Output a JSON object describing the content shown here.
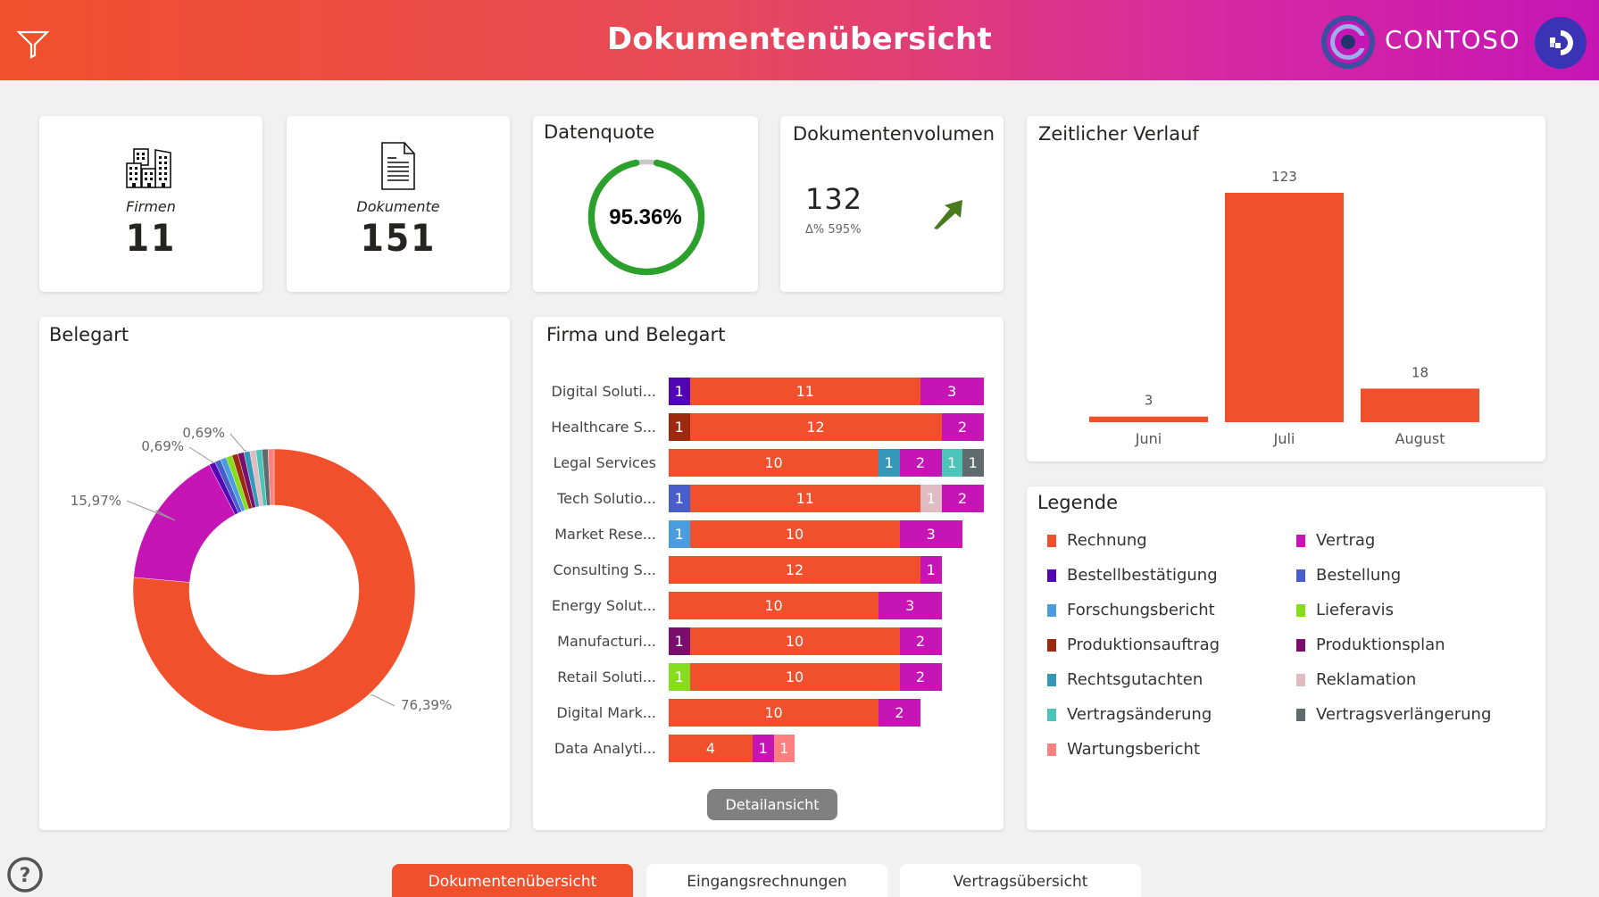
{
  "header": {
    "title": "Dokumentenübersicht",
    "brand": "CONTOSO",
    "icons": {
      "filter": "filter-icon",
      "logo": "contoso-logo-icon",
      "exit": "exit-icon"
    }
  },
  "kpis": {
    "firmen": {
      "label": "Firmen",
      "value": "11",
      "icon": "buildings-icon"
    },
    "dokumente": {
      "label": "Dokumente",
      "value": "151",
      "icon": "document-icon"
    },
    "datenquote": {
      "title": "Datenquote",
      "value_text": "95.36%",
      "fraction": 0.9536,
      "color": "#2ca02c"
    },
    "volumen": {
      "title": "Dokumentenvolumen",
      "value": "132",
      "delta": "Δ% 595%",
      "trend_icon": "trend-up-arrow-icon",
      "trend_color": "#4a7a1e"
    }
  },
  "colors": {
    "Rechnung": "#f0502b",
    "Vertrag": "#c516b5",
    "Bestellbestätigung": "#5205b5",
    "Bestellung": "#4a5ecb",
    "Forschungsbericht": "#4b9de0",
    "Lieferavis": "#85dd1e",
    "Produktionsauftrag": "#9d2a0e",
    "Produktionsplan": "#7a0e6c",
    "Rechtsgutachten": "#3498b8",
    "Reklamation": "#e0bcc2",
    "Vertragsänderung": "#4cc4ba",
    "Vertragsverlängerung": "#5f6b6d",
    "Wartungsbericht": "#fd8080"
  },
  "chart_data": [
    {
      "type": "pie",
      "title": "Belegart",
      "donut": true,
      "categories": [
        "Rechnung",
        "Vertrag",
        "Bestellbestätigung",
        "Bestellung",
        "Forschungsbericht",
        "Lieferavis",
        "Produktionsauftrag",
        "Produktionsplan",
        "Rechtsgutachten",
        "Reklamation",
        "Vertragsänderung",
        "Vertragsverlängerung",
        "Wartungsbericht"
      ],
      "values": [
        76.39,
        15.97,
        0.69,
        0.69,
        0.69,
        0.69,
        0.69,
        0.69,
        0.69,
        0.69,
        0.69,
        0.69,
        0.69
      ],
      "data_labels": [
        {
          "category": "Rechnung",
          "text": "76,39%"
        },
        {
          "category": "Vertrag",
          "text": "15,97%"
        },
        {
          "category": "Bestellbestätigung",
          "text": "0,69%"
        },
        {
          "category": "Rechtsgutachten",
          "text": "0,69%"
        }
      ]
    },
    {
      "type": "bar",
      "orientation": "horizontal",
      "stacked": true,
      "title": "Firma und Belegart",
      "categories": [
        "Digital Soluti...",
        "Healthcare S...",
        "Legal Services",
        "Tech Solutio...",
        "Market Rese...",
        "Consulting S...",
        "Energy Solut...",
        "Manufacturi...",
        "Retail Soluti...",
        "Digital Mark...",
        "Data Analyti..."
      ],
      "rows": [
        [
          {
            "type": "Bestellbestätigung",
            "value": 1
          },
          {
            "type": "Rechnung",
            "value": 11
          },
          {
            "type": "Vertrag",
            "value": 3
          }
        ],
        [
          {
            "type": "Produktionsauftrag",
            "value": 1
          },
          {
            "type": "Rechnung",
            "value": 12
          },
          {
            "type": "Vertrag",
            "value": 2
          }
        ],
        [
          {
            "type": "Rechnung",
            "value": 10
          },
          {
            "type": "Rechtsgutachten",
            "value": 1
          },
          {
            "type": "Vertrag",
            "value": 2
          },
          {
            "type": "Vertragsänderung",
            "value": 1
          },
          {
            "type": "Vertragsverlängerung",
            "value": 1
          }
        ],
        [
          {
            "type": "Bestellung",
            "value": 1
          },
          {
            "type": "Rechnung",
            "value": 11
          },
          {
            "type": "Reklamation",
            "value": 1
          },
          {
            "type": "Vertrag",
            "value": 2
          }
        ],
        [
          {
            "type": "Forschungsbericht",
            "value": 1
          },
          {
            "type": "Rechnung",
            "value": 10
          },
          {
            "type": "Vertrag",
            "value": 3
          }
        ],
        [
          {
            "type": "Rechnung",
            "value": 12
          },
          {
            "type": "Vertrag",
            "value": 1
          }
        ],
        [
          {
            "type": "Rechnung",
            "value": 10
          },
          {
            "type": "Vertrag",
            "value": 3
          }
        ],
        [
          {
            "type": "Produktionsplan",
            "value": 1
          },
          {
            "type": "Rechnung",
            "value": 10
          },
          {
            "type": "Vertrag",
            "value": 2
          }
        ],
        [
          {
            "type": "Lieferavis",
            "value": 1
          },
          {
            "type": "Rechnung",
            "value": 10
          },
          {
            "type": "Vertrag",
            "value": 2
          }
        ],
        [
          {
            "type": "Rechnung",
            "value": 10
          },
          {
            "type": "Vertrag",
            "value": 2
          }
        ],
        [
          {
            "type": "Rechnung",
            "value": 4
          },
          {
            "type": "Vertrag",
            "value": 1
          },
          {
            "type": "Wartungsbericht",
            "value": 1
          }
        ]
      ],
      "xlim": [
        0,
        15
      ]
    },
    {
      "type": "bar",
      "title": "Zeitlicher Verlauf",
      "categories": [
        "Juni",
        "Juli",
        "August"
      ],
      "values": [
        3,
        123,
        18
      ],
      "color": "#f0502b",
      "xlabel": "",
      "ylabel": "",
      "ylim": [
        0,
        123
      ]
    }
  ],
  "detail_button": "Detailansicht",
  "legend": {
    "title": "Legende",
    "items": [
      {
        "label": "Rechnung",
        "color": "#f0502b"
      },
      {
        "label": "Vertrag",
        "color": "#c516b5"
      },
      {
        "label": "Bestellbestätigung",
        "color": "#5205b5"
      },
      {
        "label": "Bestellung",
        "color": "#4a5ecb"
      },
      {
        "label": "Forschungsbericht",
        "color": "#4b9de0"
      },
      {
        "label": "Lieferavis",
        "color": "#85dd1e"
      },
      {
        "label": "Produktionsauftrag",
        "color": "#9d2a0e"
      },
      {
        "label": "Produktionsplan",
        "color": "#7a0e6c"
      },
      {
        "label": "Rechtsgutachten",
        "color": "#3498b8"
      },
      {
        "label": "Reklamation",
        "color": "#e0bcc2"
      },
      {
        "label": "Vertragsänderung",
        "color": "#4cc4ba"
      },
      {
        "label": "Vertragsverlängerung",
        "color": "#5f6b6d"
      },
      {
        "label": "Wartungsbericht",
        "color": "#fd8080"
      }
    ]
  },
  "tabs": [
    {
      "label": "Dokumentenübersicht",
      "active": true
    },
    {
      "label": "Eingangsrechnungen",
      "active": false
    },
    {
      "label": "Vertragsübersicht",
      "active": false
    }
  ],
  "help_icon": "help-icon"
}
